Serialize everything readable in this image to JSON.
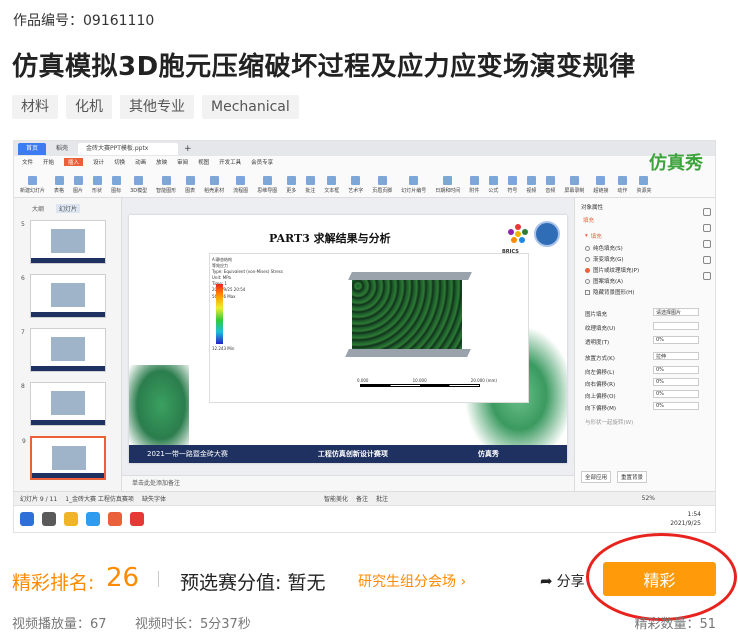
{
  "header": {
    "work_no": "作品编号：09161110",
    "title": "仿真模拟3D胞元压缩破坏过程及应力应变场演变规律",
    "tags": [
      "材料",
      "化机",
      "其他专业",
      "Mechanical"
    ]
  },
  "video": {
    "tabs": {
      "home": "首页",
      "second": "稻壳",
      "file": "金砖大赛PPT模板.pptx"
    },
    "menu": [
      "文件",
      "开始",
      "插入",
      "设计",
      "切换",
      "动画",
      "放映",
      "审阅",
      "视图",
      "开发工具",
      "会员专享"
    ],
    "menu_active": "插入",
    "ribbon": [
      "新建幻灯片",
      "表格",
      "图片",
      "形状",
      "图标",
      "3D模型",
      "智能图形",
      "图表",
      "稻壳素材",
      "流程图",
      "思维导图",
      "更多",
      "批注",
      "文本框",
      "艺术字",
      "页眉页脚",
      "幻灯片编号",
      "日期和时间",
      "附件",
      "公式",
      "符号",
      "视频",
      "音频",
      "屏幕录制",
      "超链接",
      "动作",
      "资源夹"
    ],
    "logo": "仿真秀",
    "left_tabs": [
      "大纲",
      "幻灯片"
    ],
    "slide_numbers": [
      "5",
      "6",
      "7",
      "8",
      "9"
    ],
    "slide": {
      "heading": "PART3    求解结果与分析",
      "brics": "BRICS",
      "legend": [
        "A:静态结构",
        "等效应力",
        "Type: Equivalent (von-Mises) Stress",
        "Unit: MPa",
        "Time: 1",
        "2021/9/25 20:54",
        "56.696 Max",
        "12.243 Min"
      ],
      "scale": [
        "0.000",
        "10.000",
        "20.000 (mm)"
      ],
      "footer": [
        "2021一带一路暨金砖大赛",
        "工程仿真创新设计赛项",
        "仿真秀"
      ]
    },
    "note_placeholder": "单击此处添加备注",
    "right_pane": {
      "title": "对象属性",
      "tab": "填充",
      "fill_section": "填充",
      "options": [
        "纯色填充(S)",
        "渐变填充(G)",
        "图片或纹理填充(P)",
        "图案填充(A)",
        "隐藏背景图形(H)"
      ],
      "rows": [
        "图片填充",
        "纹理填充(U)",
        "透明度(T)",
        "放置方式(K)",
        "向左偏移(L)",
        "向右偏移(R)",
        "向上偏移(O)",
        "向下偏移(M)"
      ],
      "picture_fill": "请选择图片",
      "placement": "拉伸",
      "offset": "0%",
      "transparency": "0%",
      "rotate": "与形状一起旋转(W)",
      "apply_all": "全部应用",
      "reset": "重置背景"
    },
    "status": [
      "幻灯片 9 / 11",
      "1_金砖大赛 工程仿真赛项",
      "缺失字体",
      "智能美化",
      "备注",
      "批注"
    ],
    "zoom": "52%",
    "clock_time": "1:54",
    "clock_date": "2021/9/25"
  },
  "info": {
    "rank_label": "精彩排名:",
    "rank_value": "26",
    "pre_label": "预选赛分值: 暂无",
    "venue_link": "研究生组分会场 ›",
    "share_label": "分享",
    "action_button": "精彩",
    "views": "视频播放量：67",
    "duration": "视频时长：5分37秒",
    "count": "精彩数量：51"
  }
}
